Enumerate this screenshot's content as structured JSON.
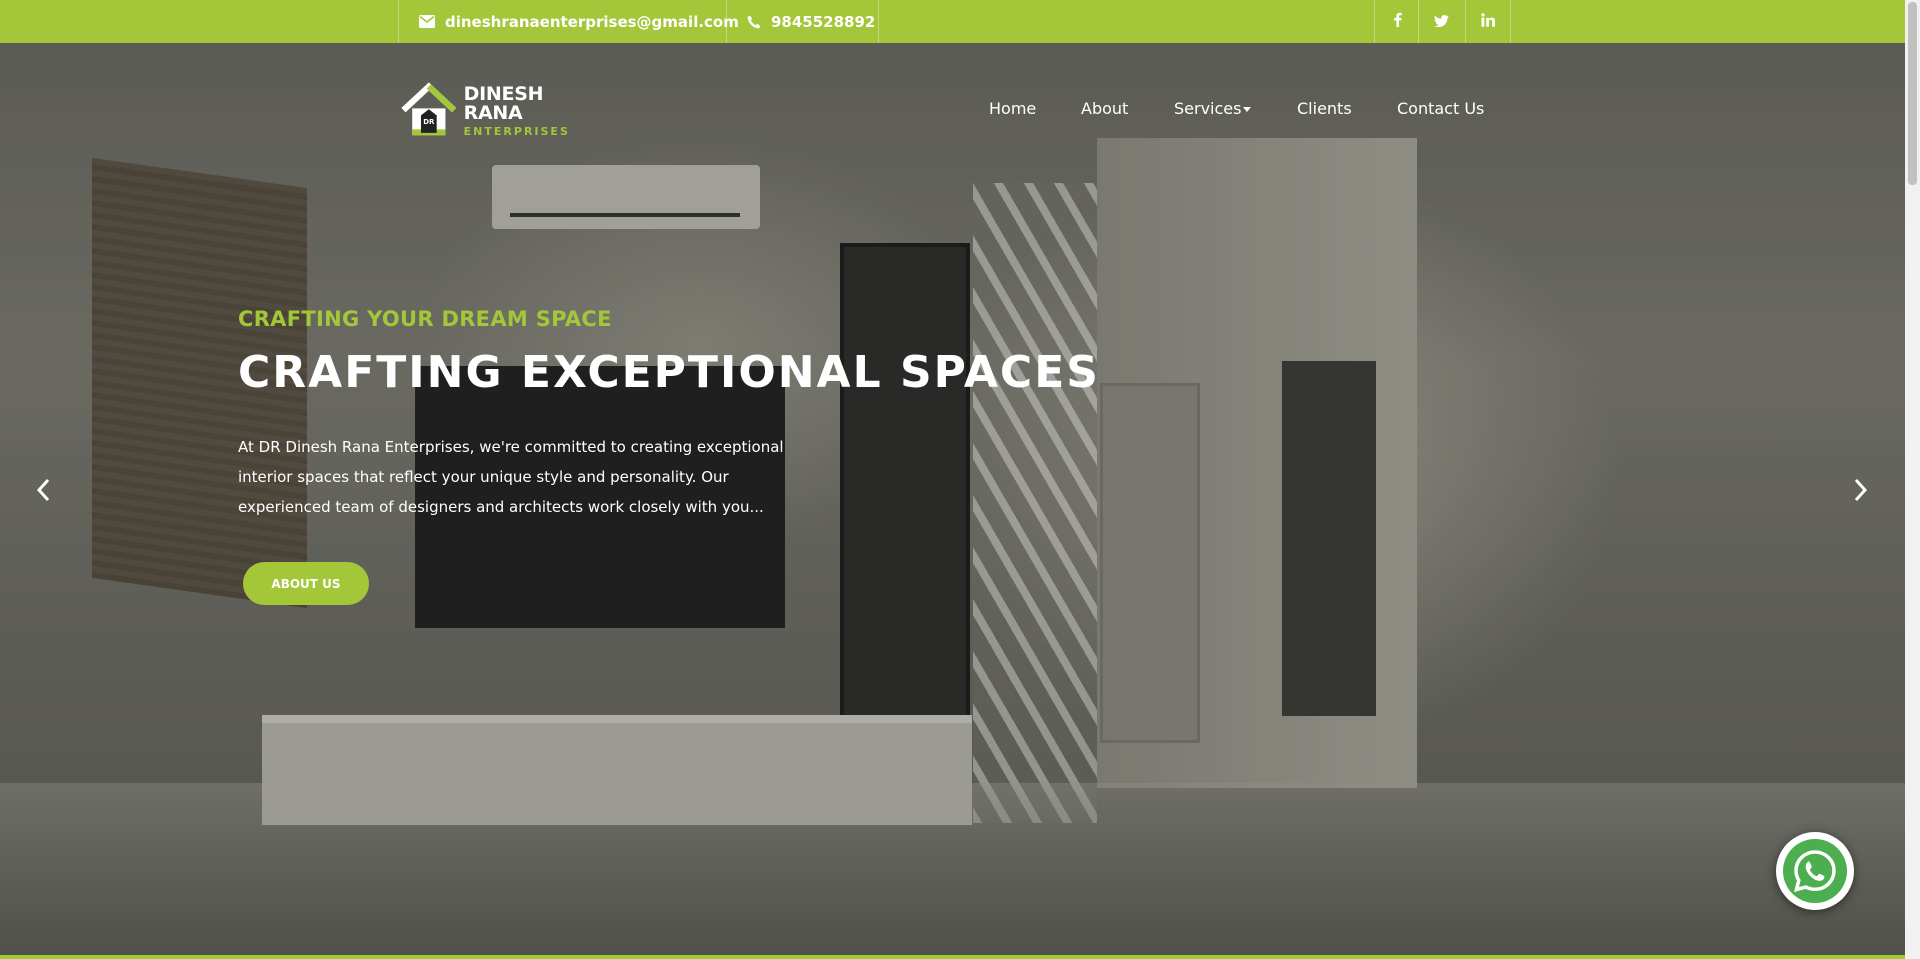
{
  "topbar": {
    "email": "dineshranaenterprises@gmail.com",
    "phone": "9845528892",
    "social": [
      "facebook-icon",
      "twitter-icon",
      "linkedin-icon"
    ]
  },
  "logo": {
    "badge": "DR",
    "main": "DINESH RANA",
    "sub": "ENTERPRISES"
  },
  "nav": {
    "items": [
      "Home",
      "About",
      "Services",
      "Clients",
      "Contact Us"
    ]
  },
  "hero": {
    "kicker": "CRAFTING YOUR DREAM SPACE",
    "headline": "CRAFTING EXCEPTIONAL SPACES",
    "description": "At DR Dinesh Rana Enterprises, we're committed to creating exceptional interior spaces that reflect your unique style and personality. Our experienced team of designers and architects work closely with you...",
    "button": "ABOUT US"
  },
  "colors": {
    "accent": "#a4c639",
    "whatsapp": "#4cae4f"
  }
}
